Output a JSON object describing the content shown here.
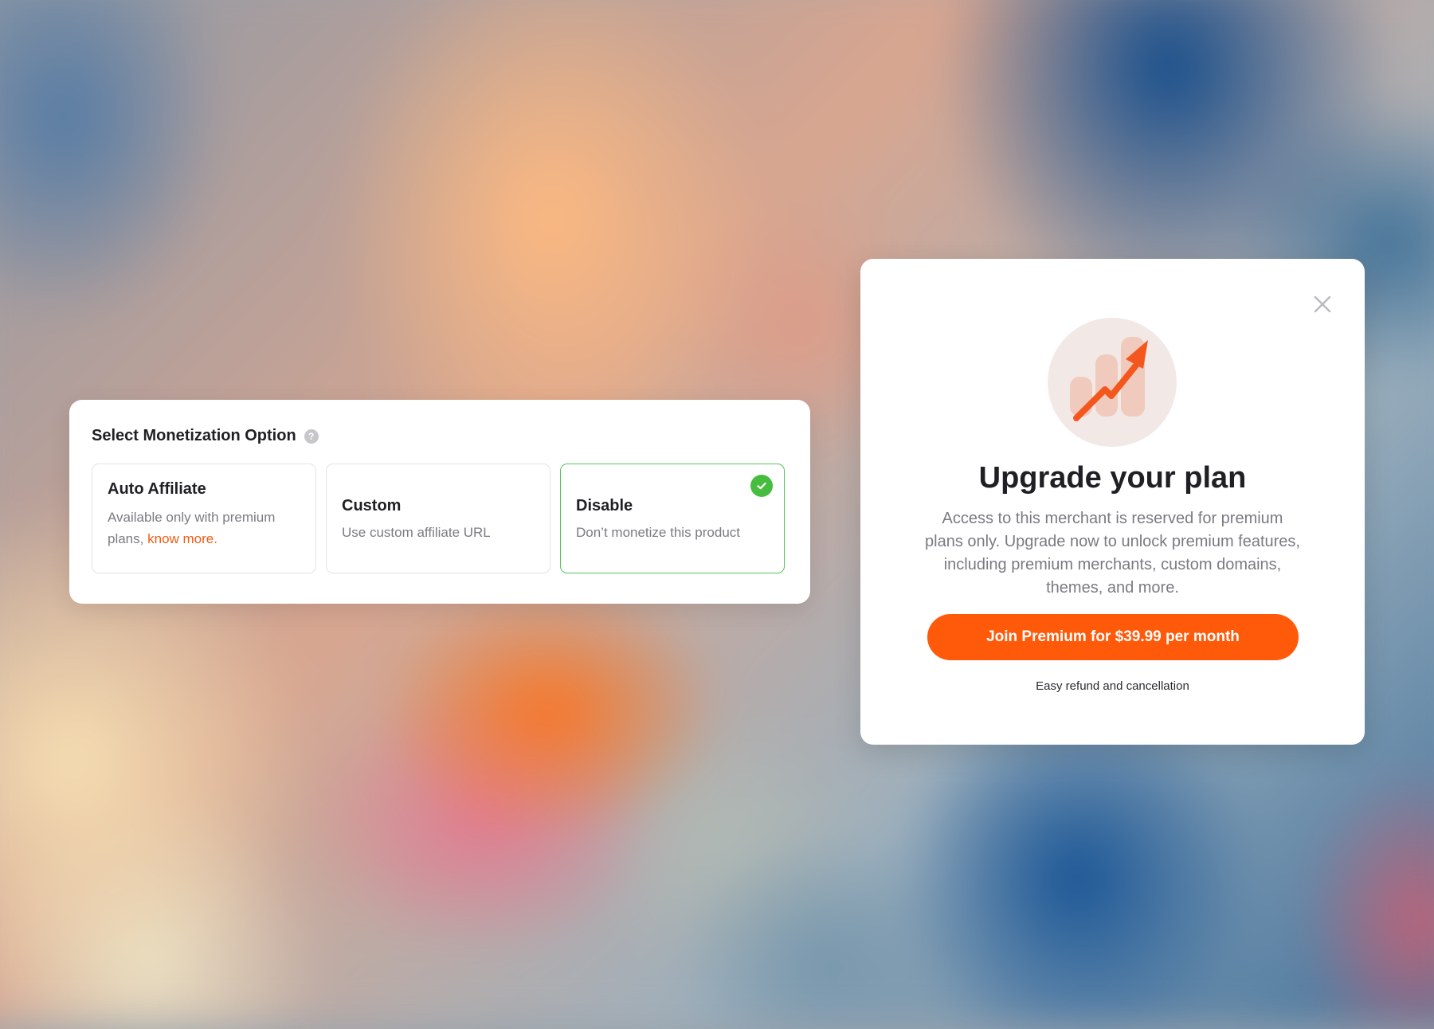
{
  "monetization": {
    "title": "Select Monetization Option",
    "help_glyph": "?",
    "options": [
      {
        "title": "Auto Affiliate",
        "description": "Available only with premium plans,",
        "link_text": "know more.",
        "selected": false
      },
      {
        "title": "Custom",
        "description": "Use custom affiliate URL",
        "selected": false
      },
      {
        "title": "Disable",
        "description": "Don’t monetize this product",
        "selected": true
      }
    ]
  },
  "upgrade_modal": {
    "title": "Upgrade your plan",
    "description": "Access to this merchant is reserved for premium plans only. Upgrade now to unlock premium features, including premium merchants, custom domains, themes, and more.",
    "cta_label": "Join Premium for $39.99 per month",
    "footnote": "Easy refund and cancellation",
    "icons": {
      "close": "close-icon",
      "hero": "growth-chart-icon"
    }
  },
  "colors": {
    "accent": "#ff5a0a",
    "link": "#f45b12",
    "selected_border": "#54c45a",
    "check_green": "#47bd3f"
  }
}
